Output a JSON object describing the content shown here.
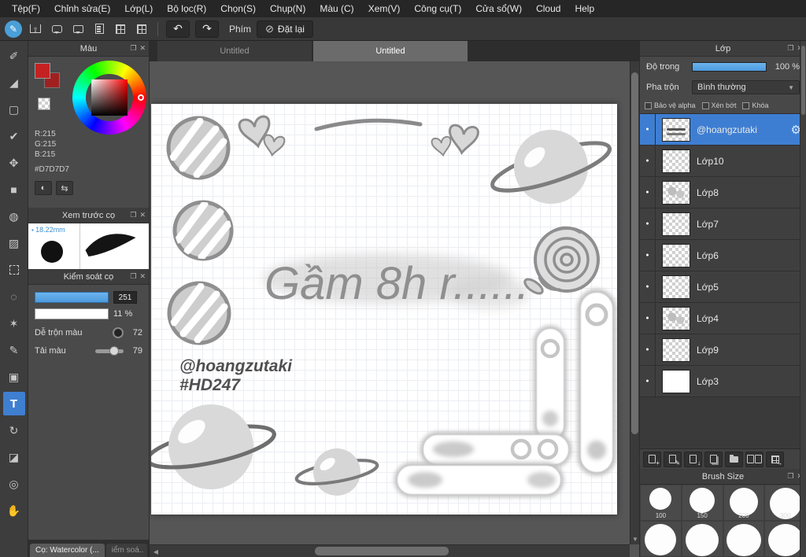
{
  "menubar": {
    "items": [
      "Tệp(F)",
      "Chỉnh sửa(E)",
      "Lớp(L)",
      "Bộ lọc(R)",
      "Chọn(S)",
      "Chụp(N)",
      "Màu (C)",
      "Xem(V)",
      "Công cụ(T)",
      "Cửa sổ(W)",
      "Cloud",
      "Help"
    ]
  },
  "toolbar": {
    "phim": "Phím",
    "reset": "Đặt lại"
  },
  "doc_tabs": {
    "tab1": "Untitled",
    "tab2": "Untitled"
  },
  "color_panel": {
    "title": "Màu",
    "r": "R:215",
    "g": "G:215",
    "b": "B:215",
    "hex": "#D7D7D7"
  },
  "preview_panel": {
    "title": "Xem trước cọ",
    "size": "18.22mm"
  },
  "control_panel": {
    "title": "Kiểm soát cọ",
    "size_value": "251",
    "opacity_value": "11 %",
    "mix_label": "Dễ trộn màu",
    "mix_value": "72",
    "load_label": "Tải màu",
    "load_value": "79"
  },
  "panel_tabs": {
    "brush": "Cọ: Watercolor (...",
    "control": "iểm soá.."
  },
  "layer_panel": {
    "title": "Lớp",
    "opacity_label": "Độ trong",
    "opacity_value": "100 %",
    "blend_label": "Pha trộn",
    "blend_value": "Bình thường",
    "check1": "Bảo vệ alpha",
    "check2": "Xén bớt",
    "check3": "Khóa",
    "layers": [
      {
        "name": "@hoangzutaki"
      },
      {
        "name": "Lớp10"
      },
      {
        "name": "Lớp8"
      },
      {
        "name": "Lớp7"
      },
      {
        "name": "Lớp6"
      },
      {
        "name": "Lớp5"
      },
      {
        "name": "Lớp4"
      },
      {
        "name": "Lớp9"
      },
      {
        "name": "Lớp3"
      }
    ]
  },
  "brush_size_panel": {
    "title": "Brush Size",
    "sizes": [
      "100",
      "150",
      "200",
      "300"
    ]
  },
  "canvas": {
    "caption": "Gầm 8h r......",
    "signature": "@hoangzutaki",
    "hashtag": "#HD247"
  },
  "colors": {
    "accent": "#4a9fd8",
    "selected_layer": "#3e7ed2",
    "current_color_hex": "#D7D7D7"
  }
}
